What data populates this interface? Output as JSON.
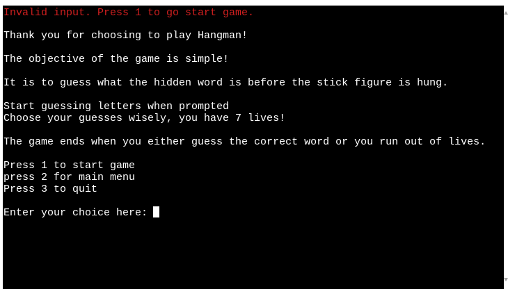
{
  "terminal": {
    "error_line": "Invalid input. Press 1 to go start game.",
    "lines": [
      "Thank you for choosing to play Hangman!",
      "The objective of the game is simple!",
      "It is to guess what the hidden word is before the stick figure is hung.",
      "Start guessing letters when prompted",
      "Choose your guesses wisely, you have 7 lives!",
      "The game ends when you either guess the correct word or you run out of lives.",
      "Press 1 to start game",
      "press 2 for main menu",
      "Press 3 to quit"
    ],
    "prompt": "Enter your choice here: "
  },
  "colors": {
    "background": "#000000",
    "text": "#ffffff",
    "error": "#d11f1f"
  },
  "icons": {
    "scroll_up": "scroll-up-arrow-icon",
    "scroll_down": "scroll-down-arrow-icon"
  }
}
